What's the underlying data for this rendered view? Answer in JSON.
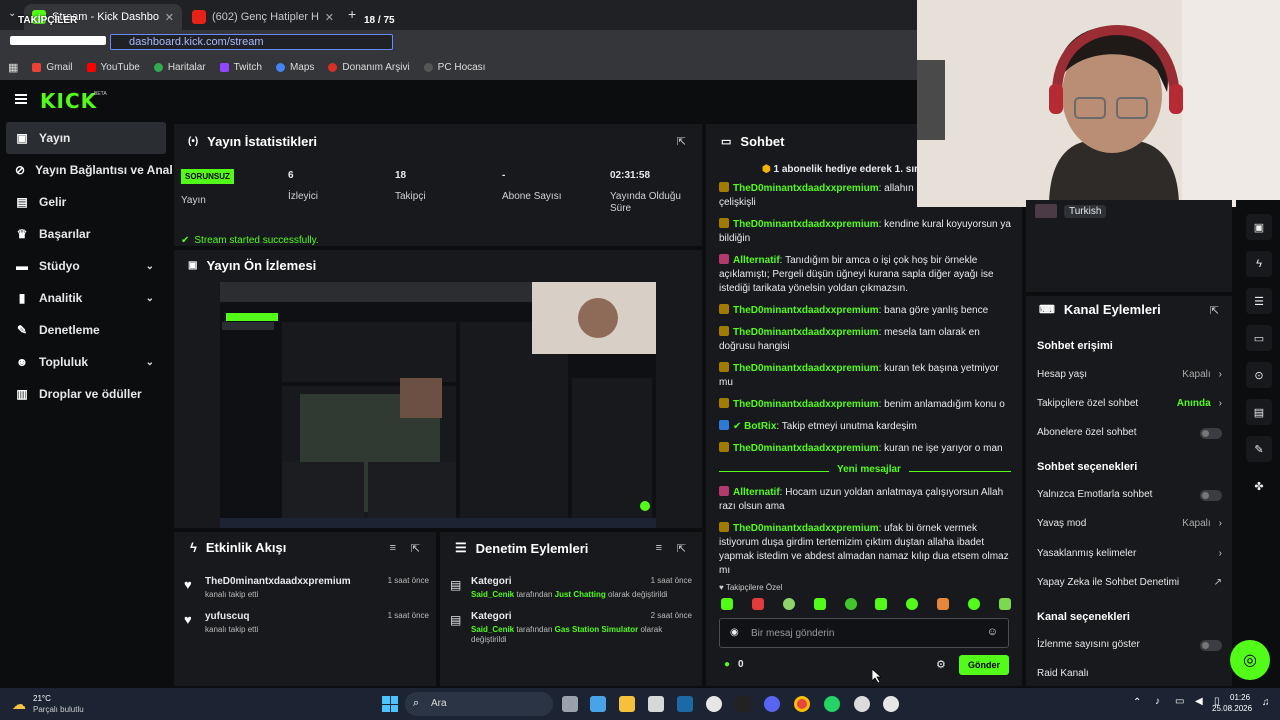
{
  "browser": {
    "tabs": [
      {
        "label": "Stream - Kick Dashboard",
        "close": "✕"
      },
      {
        "label": "(602) Genç Hatipler Hutbe Yarış…",
        "close": "✕"
      }
    ],
    "new_tab": "+",
    "counter": "18 / 75",
    "overlay_title": "TAKİPÇİLER",
    "url": "dashboard.kick.com/stream",
    "bookmarks": [
      "Gmail",
      "YouTube",
      "Haritalar",
      "Twitch",
      "Maps",
      "Donanım Arşivi",
      "PC Hocası"
    ],
    "colors": {
      "accent": "#53fc18",
      "panel": "#17191c",
      "bg": "#0b0d0f"
    }
  },
  "brand": {
    "logo": "KICK",
    "beta": "BETA"
  },
  "sidebar": {
    "items": [
      {
        "label": "Yayın",
        "icon": "video-icon"
      },
      {
        "label": "Yayın Bağlantısı ve Anahtar",
        "icon": "link-icon"
      },
      {
        "label": "Gelir",
        "icon": "revenue-icon"
      },
      {
        "label": "Başarılar",
        "icon": "trophy-icon"
      },
      {
        "label": "Stüdyo",
        "icon": "studio-icon",
        "chevron": "⌄"
      },
      {
        "label": "Analitik",
        "icon": "chart-icon",
        "chevron": "⌄"
      },
      {
        "label": "Denetleme",
        "icon": "wrench-icon"
      },
      {
        "label": "Topluluk",
        "icon": "people-icon",
        "chevron": "⌄"
      },
      {
        "label": "Droplar ve ödüller",
        "icon": "gift-icon"
      }
    ]
  },
  "stats": {
    "title": "Yayın İstatistikleri",
    "status_badge": "SORUNSUZ",
    "status_label": "Yayın",
    "viewers": {
      "value": "6",
      "label": "İzleyici"
    },
    "followers": {
      "value": "18",
      "label": "Takipçi"
    },
    "subs": {
      "value": "-",
      "label": "Abone Sayısı"
    },
    "uptime": {
      "value": "02:31:58",
      "label": "Yayında Olduğu Süre"
    },
    "success": "Stream started successfully."
  },
  "preview": {
    "title": "Yayın Ön İzlemesi"
  },
  "activity": {
    "title": "Etkinlik Akışı",
    "items": [
      {
        "name": "TheD0minantxdaadxxpremium",
        "sub": "kanalı takip etti",
        "time": "1 saat önce"
      },
      {
        "name": "yufuscuq",
        "sub": "kanalı takip etti",
        "time": "1 saat önce"
      }
    ]
  },
  "moderation": {
    "title": "Denetim Eylemleri",
    "items": [
      {
        "head": "Kategori",
        "user": "Said_Cenik",
        "mid": "tarafından",
        "cat": "Just Chatting",
        "tail": "olarak değiştirildi",
        "time": "1 saat önce"
      },
      {
        "head": "Kategori",
        "user": "Said_Cenik",
        "mid": "tarafından",
        "cat": "Gas Station Simulator",
        "tail": "olarak değiştirildi",
        "time": "2 saat önce"
      }
    ]
  },
  "chat": {
    "title": "Sohbet",
    "pinned": "1 abonelik hediye ederek 1. sıra",
    "messages": [
      {
        "user": "TheD0minantxdaadxxpremium",
        "text": "allahın k yorumluyorsun çok çelişkişli"
      },
      {
        "user": "TheD0minantxdaadxxpremium",
        "text": "kendine kural koyuyorsun ya bildiğin"
      },
      {
        "user": "Allternatif",
        "text": "Tanıdığım bir amca o işi çok hoş bir örnekle açıklamıştı; Pergeli düşün üğneyi kurana sapla diğer ayağı ise istediği tarikata yönelsin yoldan çıkmazsın."
      },
      {
        "user": "TheD0minantxdaadxxpremium",
        "text": "bana göre yanlış bence"
      },
      {
        "user": "TheD0minantxdaadxxpremium",
        "text": "mesela tam olarak en doğrusu hangisi"
      },
      {
        "user": "TheD0minantxdaadxxpremium",
        "text": "kuran tek başına yetmiyor mu"
      },
      {
        "user": "TheD0minantxdaadxxpremium",
        "text": "benim anlamadığım konu o"
      },
      {
        "user": "BotRix",
        "text": "Takip etmeyi unutma kardeşim"
      },
      {
        "user": "TheD0minantxdaadxxpremium",
        "text": "kuran ne işe yarıyor o man"
      }
    ],
    "new_divider": "Yeni mesajlar",
    "new_messages": [
      {
        "user": "Allternatif",
        "text": "Hocam uzun yoldan anlatmaya çalışıyorsun Allah razı olsun ama"
      },
      {
        "user": "TheD0minantxdaadxxpremium",
        "text": "ufak bi örnek vermek istiyorum duşa girdim tertemizim çıktım duştan allaha ibadet yapmak istedim ve abdest almadan namaz kılıp dua etsem olmaz mı"
      }
    ],
    "follower_only": "Takipçilere Özel",
    "input_placeholder": "Bir mesaj gönderin",
    "points": "0",
    "send": "Gönder"
  },
  "webcam": {
    "language": "Turkish"
  },
  "kanal": {
    "title": "Kanal Eylemleri",
    "chat_access": "Sohbet erişimi",
    "rows_access": [
      {
        "label": "Hesap yaşı",
        "value": "Kapalı",
        "arrow": "›"
      },
      {
        "label": "Takipçilere özel sohbet",
        "value": "Anında",
        "arrow": "›"
      },
      {
        "label": "Abonelere özel sohbet"
      }
    ],
    "chat_options": "Sohbet seçenekleri",
    "rows_options": [
      {
        "label": "Yalnızca Emotlarla sohbet"
      },
      {
        "label": "Yavaş mod",
        "value": "Kapalı",
        "arrow": "›"
      },
      {
        "label": "Yasaklanmış kelimeler",
        "arrow": "›"
      },
      {
        "label": "Yapay Zeka ile Sohbet Denetimi",
        "arrow": "↗"
      }
    ],
    "channel_options": "Kanal seçenekleri",
    "rows_channel": [
      {
        "label": "İzlenme sayısını göster"
      },
      {
        "label": "Raid Kanalı"
      }
    ]
  },
  "taskbar": {
    "weather_temp": "21°C",
    "weather_desc": "Parçalı bulutlu",
    "search": "Ara",
    "time": "01:26",
    "date": "25.08.2026"
  }
}
